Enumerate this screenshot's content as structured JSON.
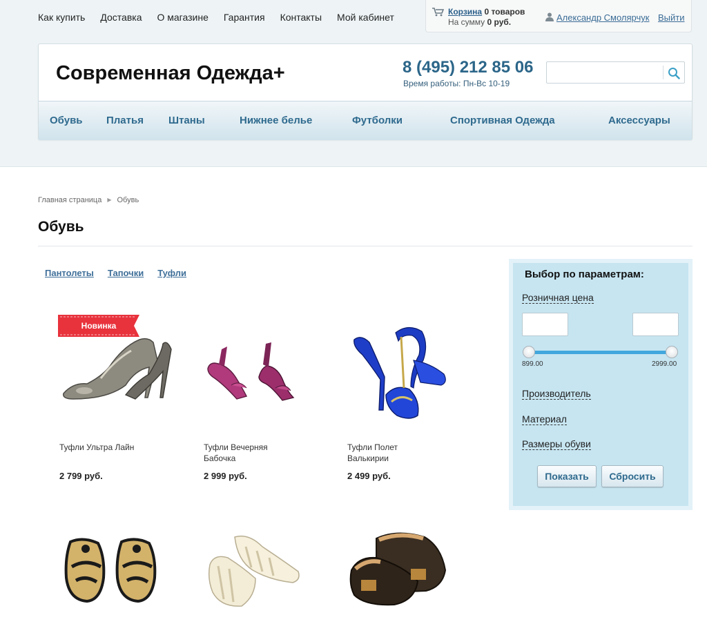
{
  "topnav": [
    "Как купить",
    "Доставка",
    "О магазине",
    "Гарантия",
    "Контакты",
    "Мой кабинет"
  ],
  "cart": {
    "link": "Корзина",
    "count": "0 товаров",
    "sum_prefix": "На сумму",
    "sum": "0 руб."
  },
  "user": {
    "name": "Александр Смолярчук",
    "logout": "Выйти"
  },
  "header": {
    "logo": "Современная Одежда+",
    "phone": "8 (495) 212 85 06",
    "hours": "Время работы: Пн-Вс 10-19",
    "search_placeholder": ""
  },
  "catnav": [
    "Обувь",
    "Платья",
    "Штаны",
    "Нижнее белье",
    "Футболки",
    "Спортивная Одежда",
    "Аксессуары"
  ],
  "breadcrumb": {
    "home": "Главная страница",
    "current": "Обувь"
  },
  "page_title": "Обувь",
  "subcategories": [
    "Пантолеты",
    "Тапочки",
    "Туфли"
  ],
  "badge": "Новинка",
  "products": [
    {
      "name": "Туфли Ультра Лайн",
      "price": "2 799 руб."
    },
    {
      "name": "Туфли Вечерняя Бабочка",
      "price": "2 999 руб."
    },
    {
      "name": "Туфли Полет Валькирии",
      "price": "2 499 руб."
    }
  ],
  "filter": {
    "title": "Выбор по параметрам:",
    "price_label": "Розничная цена",
    "min": "899.00",
    "max": "2999.00",
    "manufacturer": "Производитель",
    "material": "Материал",
    "sizes": "Размеры обуви",
    "show": "Показать",
    "reset": "Сбросить"
  },
  "colors": {
    "accent": "#2f6a8e",
    "filter_bg": "#c6e5f1",
    "badge": "#e8323c",
    "slider": "#41a7dd"
  }
}
